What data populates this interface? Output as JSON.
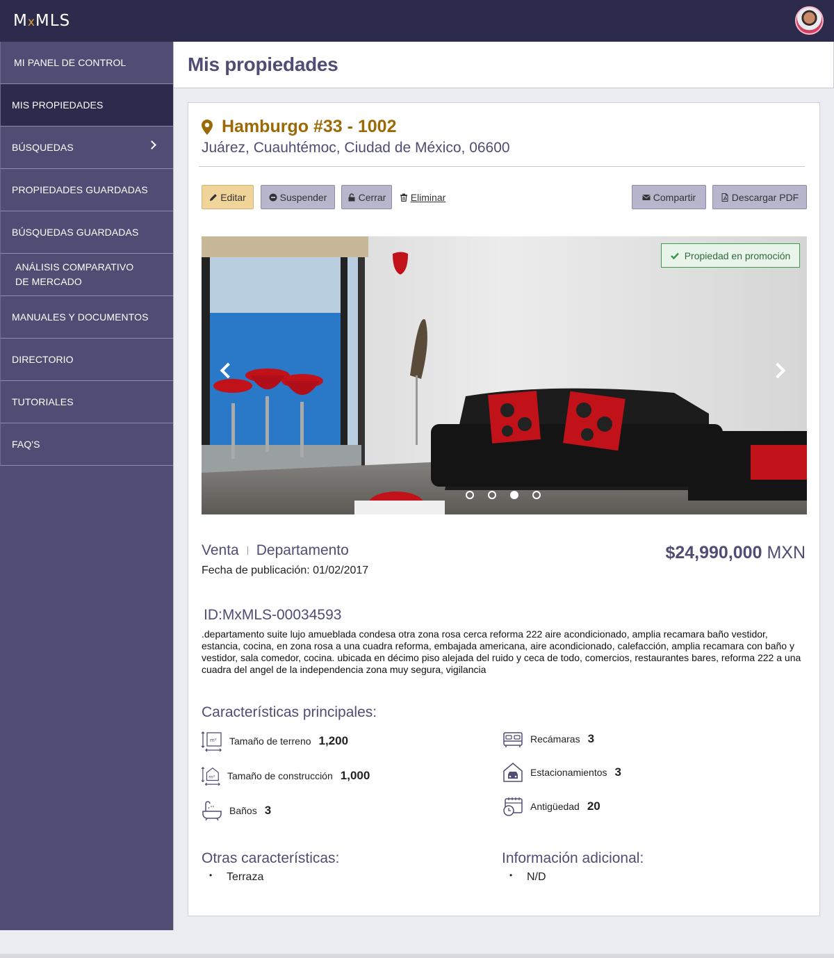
{
  "header": {
    "logo_left": "M",
    "logo_x": "x",
    "logo_right": "MLS"
  },
  "sidebar": {
    "items": [
      {
        "label": "MI PANEL DE CONTROL"
      },
      {
        "label": "MIS PROPIEDADES"
      },
      {
        "label": "BÚSQUEDAS"
      },
      {
        "label": "PROPIEDADES GUARDADAS"
      },
      {
        "label": "BÚSQUEDAS GUARDADAS"
      },
      {
        "label": "ANÁLISIS COMPARATIVO\nDE MERCADO"
      },
      {
        "label": "MANUALES Y DOCUMENTOS"
      },
      {
        "label": "DIRECTORIO"
      },
      {
        "label": "TUTORIALES"
      },
      {
        "label": "FAQ'S"
      }
    ]
  },
  "page": {
    "title": "Mis propiedades"
  },
  "property": {
    "title": "Hamburgo #33 - 1002",
    "address": "Juárez, Cuauhtémoc, Ciudad de México, 06600",
    "operation": "Venta",
    "type": "Departamento",
    "pub_date": "Fecha de publicación: 01/02/2017",
    "price_amount": "$24,990,000",
    "price_currency": "MXN",
    "id": "ID:MxMLS-00034593",
    "description": ".departamento suite lujo amueblada condesa otra zona rosa cerca reforma 222 aire acondicionado, amplia recamara baño vestidor, estancia, cocina, en zona rosa a una cuadra reforma, embajada americana, aire acondicionado, calefacción, amplia recamara con baño y vestidor, sala comedor, cocina. ubicada en décimo piso alejada del ruido y ceca de todo, comercios, restaurantes bares, reforma 222 a una cuadra del angel de la independencia zona muy segura, vigilancia"
  },
  "actions": {
    "edit": "Editar",
    "suspend": "Suspender",
    "close": "Cerrar",
    "delete": "Eliminar",
    "share": "Compartir",
    "pdf": "Descargar PDF"
  },
  "carousel": {
    "promo_label": "Propiedad en promoción",
    "total_slides": 4,
    "active_slide": 3
  },
  "features": {
    "title": "Características principales:",
    "left": [
      {
        "icon": "land-size-icon",
        "label": "Tamaño de terreno",
        "value": "1,200"
      },
      {
        "icon": "construction-size-icon",
        "label": "Tamaño de construcción",
        "value": "1,000"
      },
      {
        "icon": "bathtub-icon",
        "label": "Baños",
        "value": "3"
      }
    ],
    "right": [
      {
        "icon": "bed-icon",
        "label": "Recámaras",
        "value": "3"
      },
      {
        "icon": "garage-icon",
        "label": "Estacionamientos",
        "value": "3"
      },
      {
        "icon": "calendar-clock-icon",
        "label": "Antigüedad",
        "value": "20"
      }
    ]
  },
  "other": {
    "title": "Otras características:",
    "items": [
      "Terraza"
    ]
  },
  "additional": {
    "title": "Información adicional:",
    "items": [
      "N/D"
    ]
  },
  "colors": {
    "brand_dark": "#2c2b4b",
    "sidebar": "#4f4d74",
    "title_gold": "#9a6a06",
    "promo_green": "#3c9a4a"
  }
}
